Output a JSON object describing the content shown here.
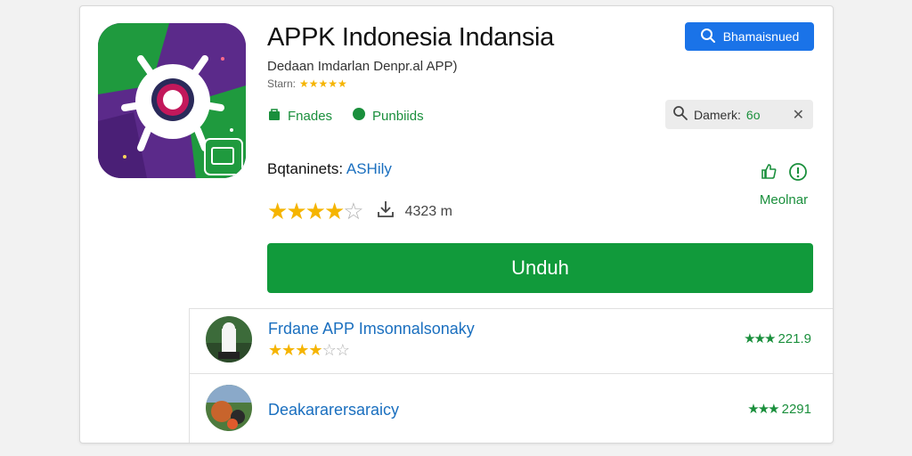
{
  "app": {
    "title": "APPK Indonesia Indansia",
    "subtitle": "Dedaan Imdarlan Denpr.al APP)",
    "rating_label": "Starn:",
    "rating_stars": "★★★★★",
    "tags": [
      {
        "label": "Fnades",
        "icon": "bag-icon"
      },
      {
        "label": "Punbiids",
        "icon": "dot-icon"
      }
    ],
    "developer_label": "Bqtaninets:",
    "developer_name": "ASHily",
    "rating_value": 3.5,
    "rating_max": 5,
    "downloads": "4323 m",
    "download_button": "Unduh"
  },
  "header": {
    "search_button": "Bhamaisnued"
  },
  "filter_chip": {
    "label": "Damerk:",
    "value": "6o"
  },
  "side_actions": {
    "label": "Meolnar"
  },
  "related": [
    {
      "title": "Frdane APP Imsonnalsonaky",
      "stars": 3.5,
      "score_stars": "★★★",
      "score": "221.9"
    },
    {
      "title": "Deakararersaraicy",
      "score_stars": "★★★",
      "score": "2291"
    }
  ],
  "colors": {
    "accent_green": "#119a3b",
    "accent_blue": "#1a73e8",
    "star_gold": "#f5b400"
  }
}
